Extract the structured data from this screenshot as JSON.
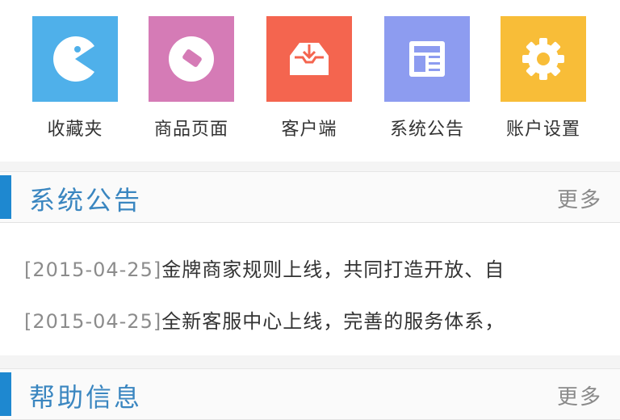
{
  "shortcuts": [
    {
      "label": "收藏夹",
      "icon": "pacman-icon",
      "color": "#4fb0ea"
    },
    {
      "label": "商品页面",
      "icon": "tag-icon",
      "color": "#d57bb6"
    },
    {
      "label": "客户端",
      "icon": "download-tray-icon",
      "color": "#f4654f"
    },
    {
      "label": "系统公告",
      "icon": "newspaper-icon",
      "color": "#8d9cf0"
    },
    {
      "label": "账户设置",
      "icon": "gear-icon",
      "color": "#f8bd38"
    }
  ],
  "announcements": {
    "title": "系统公告",
    "more_label": "更多",
    "items": [
      {
        "date": "[2015-04-25]",
        "title": "金牌商家规则上线，共同打造开放、自"
      },
      {
        "date": "[2015-04-25]",
        "title": "全新客服中心上线，完善的服务体系，"
      }
    ]
  },
  "help": {
    "title": "帮助信息",
    "more_label": "更多"
  },
  "colors": {
    "accent": "#1e88d0",
    "section_title": "#3a86c0"
  }
}
